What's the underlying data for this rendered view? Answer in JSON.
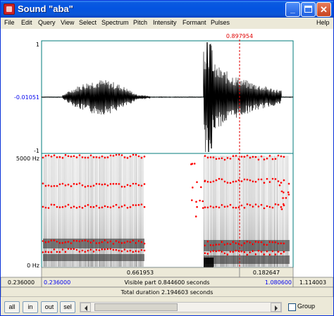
{
  "window": {
    "title": "Sound \"aba\""
  },
  "title_buttons": {
    "minimize": "_",
    "close": "✕"
  },
  "menu": [
    "File",
    "Edit",
    "Query",
    "View",
    "Select",
    "Spectrum",
    "Pitch",
    "Intensity",
    "Formant",
    "Pulses",
    "Help"
  ],
  "cursor": {
    "time": "0.897954"
  },
  "waveform": {
    "ymax": "1",
    "ymin": "-1",
    "cursor_value": "-0.01051"
  },
  "spectrogram": {
    "fmax": "5000 Hz",
    "fmin": "0 Hz"
  },
  "selection": {
    "left_duration": "0.661953",
    "right_duration": "0.182647"
  },
  "time_axis": {
    "total_start": "0.236000",
    "visible_start": "0.236000",
    "visible_label": "Visible part 0.844600 seconds",
    "visible_end": "1.080600",
    "total_end": "1.114003",
    "total_label": "Total duration 2.194603 seconds"
  },
  "buttons": {
    "all": "all",
    "in": "in",
    "out": "out",
    "sel": "sel"
  },
  "group": {
    "label": "Group"
  },
  "colors": {
    "cursor": "#e00000",
    "marker": "#ff0000",
    "axis_blue": "#0000ee",
    "plot_border": "#007b7b"
  }
}
